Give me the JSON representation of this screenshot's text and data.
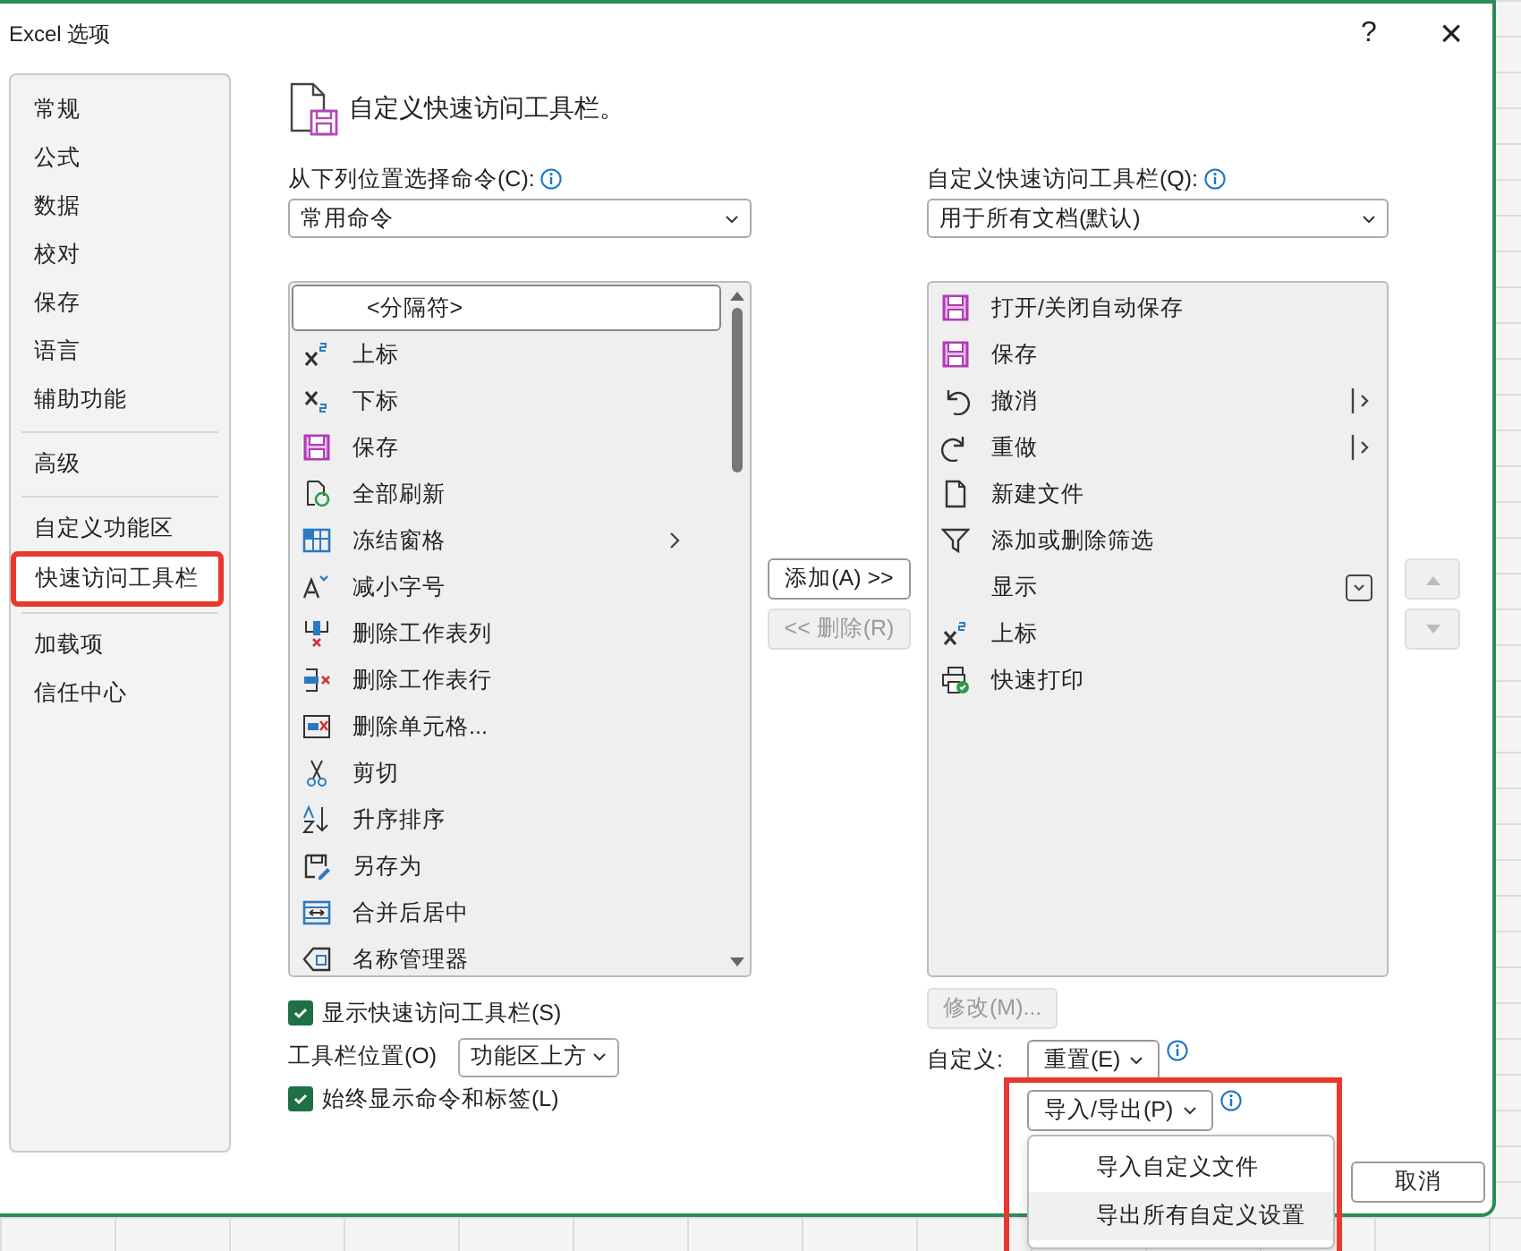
{
  "window": {
    "title": "Excel 选项",
    "help": "?",
    "close": "×"
  },
  "sidebar": {
    "items": [
      {
        "label": "常规",
        "selected": false,
        "divider_above": false
      },
      {
        "label": "公式",
        "selected": false,
        "divider_above": false
      },
      {
        "label": "数据",
        "selected": false,
        "divider_above": false
      },
      {
        "label": "校对",
        "selected": false,
        "divider_above": false
      },
      {
        "label": "保存",
        "selected": false,
        "divider_above": false
      },
      {
        "label": "语言",
        "selected": false,
        "divider_above": false
      },
      {
        "label": "辅助功能",
        "selected": false,
        "divider_above": false
      },
      {
        "label": "高级",
        "selected": false,
        "divider_above": true
      },
      {
        "label": "自定义功能区",
        "selected": false,
        "divider_above": true
      },
      {
        "label": "快速访问工具栏",
        "selected": true,
        "divider_above": false,
        "highlighted": true
      },
      {
        "label": "加载项",
        "selected": false,
        "divider_above": true
      },
      {
        "label": "信任中心",
        "selected": false,
        "divider_above": false
      }
    ]
  },
  "heading": "自定义快速访问工具栏。",
  "commands": {
    "label": "从下列位置选择命令(C):",
    "source": "常用命令",
    "items": [
      {
        "label": "<分隔符>",
        "selected": true,
        "submenu": false
      },
      {
        "label": "上标",
        "selected": false,
        "submenu": false
      },
      {
        "label": "下标",
        "selected": false,
        "submenu": false
      },
      {
        "label": "保存",
        "selected": false,
        "submenu": false
      },
      {
        "label": "全部刷新",
        "selected": false,
        "submenu": false
      },
      {
        "label": "冻结窗格",
        "selected": false,
        "submenu": true
      },
      {
        "label": "减小字号",
        "selected": false,
        "submenu": false
      },
      {
        "label": "删除工作表列",
        "selected": false,
        "submenu": false
      },
      {
        "label": "删除工作表行",
        "selected": false,
        "submenu": false
      },
      {
        "label": "删除单元格...",
        "selected": false,
        "submenu": false
      },
      {
        "label": "剪切",
        "selected": false,
        "submenu": false
      },
      {
        "label": "升序排序",
        "selected": false,
        "submenu": false
      },
      {
        "label": "另存为",
        "selected": false,
        "submenu": false
      },
      {
        "label": "合并后居中",
        "selected": false,
        "submenu": false
      },
      {
        "label": "名称管理器",
        "selected": false,
        "submenu": false
      }
    ]
  },
  "add_button": {
    "label": "添加(A) >>",
    "disabled": false
  },
  "remove_button": {
    "label": "<< 删除(R)",
    "disabled": true
  },
  "toolbar": {
    "label": "自定义快速访问工具栏(Q):",
    "scope": "用于所有文档(默认)",
    "items": [
      {
        "label": "打开/关闭自动保存",
        "kind": "plain",
        "selected": false
      },
      {
        "label": "保存",
        "kind": "plain",
        "selected": false
      },
      {
        "label": "撤消",
        "kind": "split",
        "selected": false
      },
      {
        "label": "重做",
        "kind": "split",
        "selected": false
      },
      {
        "label": "新建文件",
        "kind": "plain",
        "selected": false
      },
      {
        "label": "添加或删除筛选",
        "kind": "plain",
        "selected": false
      },
      {
        "label": "显示",
        "kind": "dropdown",
        "selected": false
      },
      {
        "label": "上标",
        "kind": "plain",
        "selected": false
      },
      {
        "label": "快速打印",
        "kind": "plain",
        "selected": false
      }
    ]
  },
  "move_up": {
    "disabled": true
  },
  "move_down": {
    "disabled": true
  },
  "modify_button": {
    "label": "修改(M)...",
    "disabled": true
  },
  "show_toolbar": {
    "label": "显示快速访问工具栏(S)",
    "checked": true
  },
  "toolbar_position": {
    "label": "工具栏位置(O)",
    "value": "功能区上方"
  },
  "always_show_labels": {
    "label": "始终显示命令和标签(L)",
    "checked": true
  },
  "customize_label": "自定义:",
  "reset_button": "重置(E)",
  "import_export": {
    "label": "导入/导出(P)",
    "highlighted": true,
    "menu": [
      {
        "label": "导入自定义文件",
        "selected": false
      },
      {
        "label": "导出所有自定义设置",
        "selected": true
      }
    ]
  },
  "cancel_button": "取消"
}
